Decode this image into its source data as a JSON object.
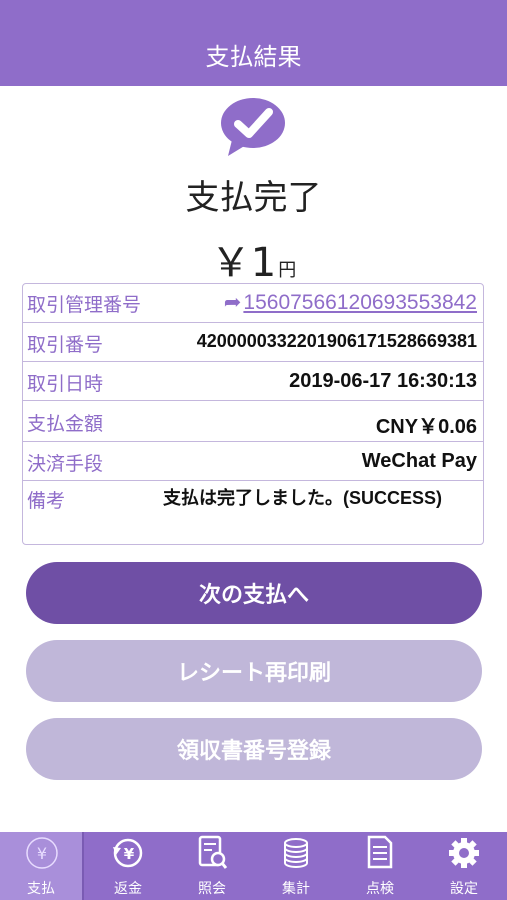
{
  "header": {
    "title": "支払結果"
  },
  "result": {
    "title": "支払完了",
    "amount": "￥1",
    "unit": "円"
  },
  "details": {
    "rows": [
      {
        "label": "取引管理番号",
        "value": "15607566120693553842"
      },
      {
        "label": "取引番号",
        "value": "4200000332201906171528669381"
      },
      {
        "label": "取引日時",
        "value": "2019-06-17 16:30:13"
      },
      {
        "label": "支払金額",
        "value": "CNY￥0.06"
      },
      {
        "label": "決済手段",
        "value": "WeChat Pay"
      },
      {
        "label": "備考",
        "value": "支払は完了しました。(SUCCESS)"
      }
    ]
  },
  "buttons": {
    "next_payment": "次の支払へ",
    "reprint_receipt": "レシート再印刷",
    "receipt_number": "領収書番号登録"
  },
  "tabs": [
    {
      "label": "支払",
      "icon": "yen-circle-icon",
      "active": true
    },
    {
      "label": "返金",
      "icon": "refund-icon",
      "active": false
    },
    {
      "label": "照会",
      "icon": "inquiry-icon",
      "active": false
    },
    {
      "label": "集計",
      "icon": "coin-stack-icon",
      "active": false
    },
    {
      "label": "点検",
      "icon": "checklist-icon",
      "active": false
    },
    {
      "label": "設定",
      "icon": "gear-icon",
      "active": false
    }
  ],
  "colors": {
    "brand": "#8f6dc9",
    "primary_button": "#6f4fa5",
    "secondary_button": "#c0b7d9"
  }
}
